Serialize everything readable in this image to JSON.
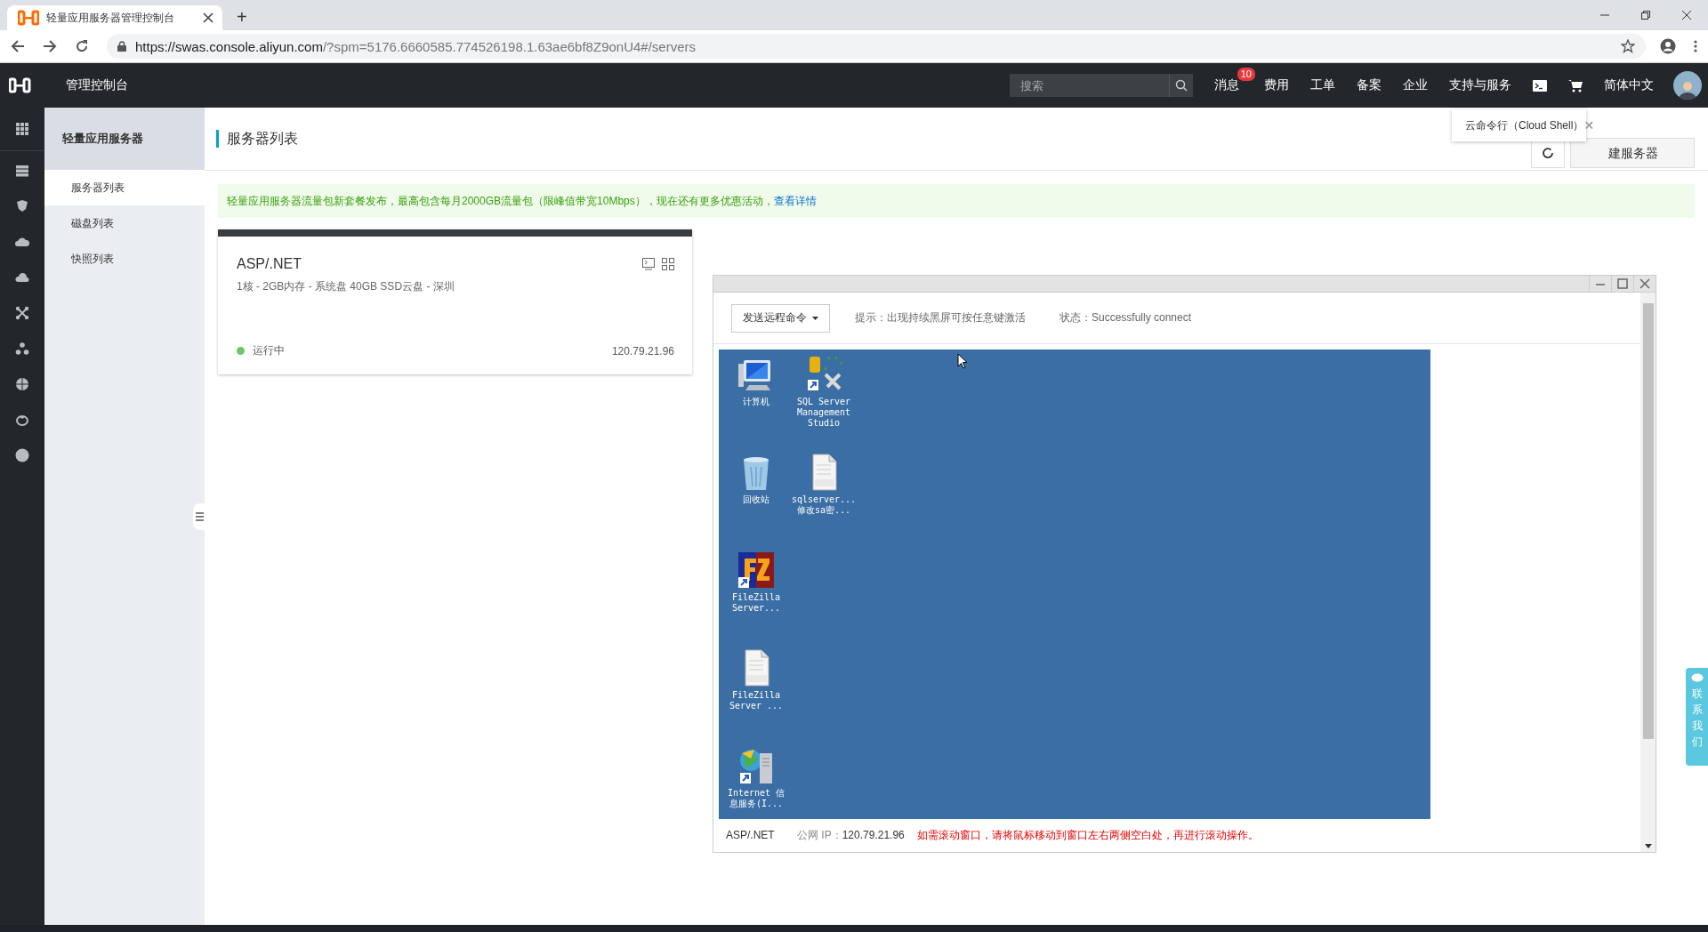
{
  "browser": {
    "tab_title": "轻量应用服务器管理控制台",
    "new_tab": "+",
    "url_host": "https://swas.console.aliyun.com",
    "url_rest": "/?spm=5176.6660585.774526198.1.63ae6bf8Z9onU4#/servers"
  },
  "topbar": {
    "title": "管理控制台",
    "search_placeholder": "搜索",
    "nav": [
      {
        "label": "消息",
        "badge": "10"
      },
      {
        "label": "费用"
      },
      {
        "label": "工单"
      },
      {
        "label": "备案"
      },
      {
        "label": "企业"
      },
      {
        "label": "支持与服务"
      }
    ],
    "language": "简体中文"
  },
  "tooltip": {
    "text": "云命令行（Cloud Shell）",
    "close": "✕"
  },
  "sidebar": {
    "title": "轻量应用服务器",
    "items": [
      {
        "label": "服务器列表",
        "selected": true
      },
      {
        "label": "磁盘列表",
        "selected": false
      },
      {
        "label": "快照列表",
        "selected": false
      }
    ]
  },
  "page": {
    "title": "服务器列表",
    "create_button": "建服务器"
  },
  "banner": {
    "text": "轻量应用服务器流量包新套餐发布，最高包含每月2000GB流量包（限峰值带宽10Mbps），现在还有更多优惠活动，",
    "link": "查看详情"
  },
  "server_card": {
    "name": "ASP/.NET",
    "spec": "1核 - 2GB内存 - 系统盘 40GB SSD云盘 - 深圳",
    "status": {
      "label": "运行中",
      "color": "#6cc76a"
    },
    "ip": "120.79.21.96"
  },
  "remote_window": {
    "command_button": "发送远程命令",
    "hint": "提示：出现持续黑屏可按任意键激活",
    "state": "状态：Successfully connect",
    "desktop_rows": [
      [
        {
          "kind": "computer",
          "lines": [
            "计算机"
          ]
        },
        {
          "kind": "sql",
          "lines": [
            "SQL Server",
            "Management",
            "Studio"
          ]
        }
      ],
      [
        {
          "kind": "recycle",
          "lines": [
            "回收站"
          ]
        },
        {
          "kind": "docx",
          "lines": [
            "sqlserver...",
            "修改sa密..."
          ]
        }
      ],
      [
        {
          "kind": "filezilla",
          "lines": [
            "FileZilla",
            "Server..."
          ]
        }
      ],
      [
        {
          "kind": "docx",
          "lines": [
            "FileZilla",
            "Server ..."
          ]
        }
      ],
      [
        {
          "kind": "iis",
          "lines": [
            "Internet 信",
            "息服务(I..."
          ]
        }
      ]
    ],
    "footer_name": "ASP/.NET",
    "footer_ip_label": "公网 IP：",
    "footer_ip": "120.79.21.96",
    "footer_warning": "如需滚动窗口，请将鼠标移动到窗口左右两侧空白处，再进行滚动操作。"
  },
  "contact": "联系我们"
}
